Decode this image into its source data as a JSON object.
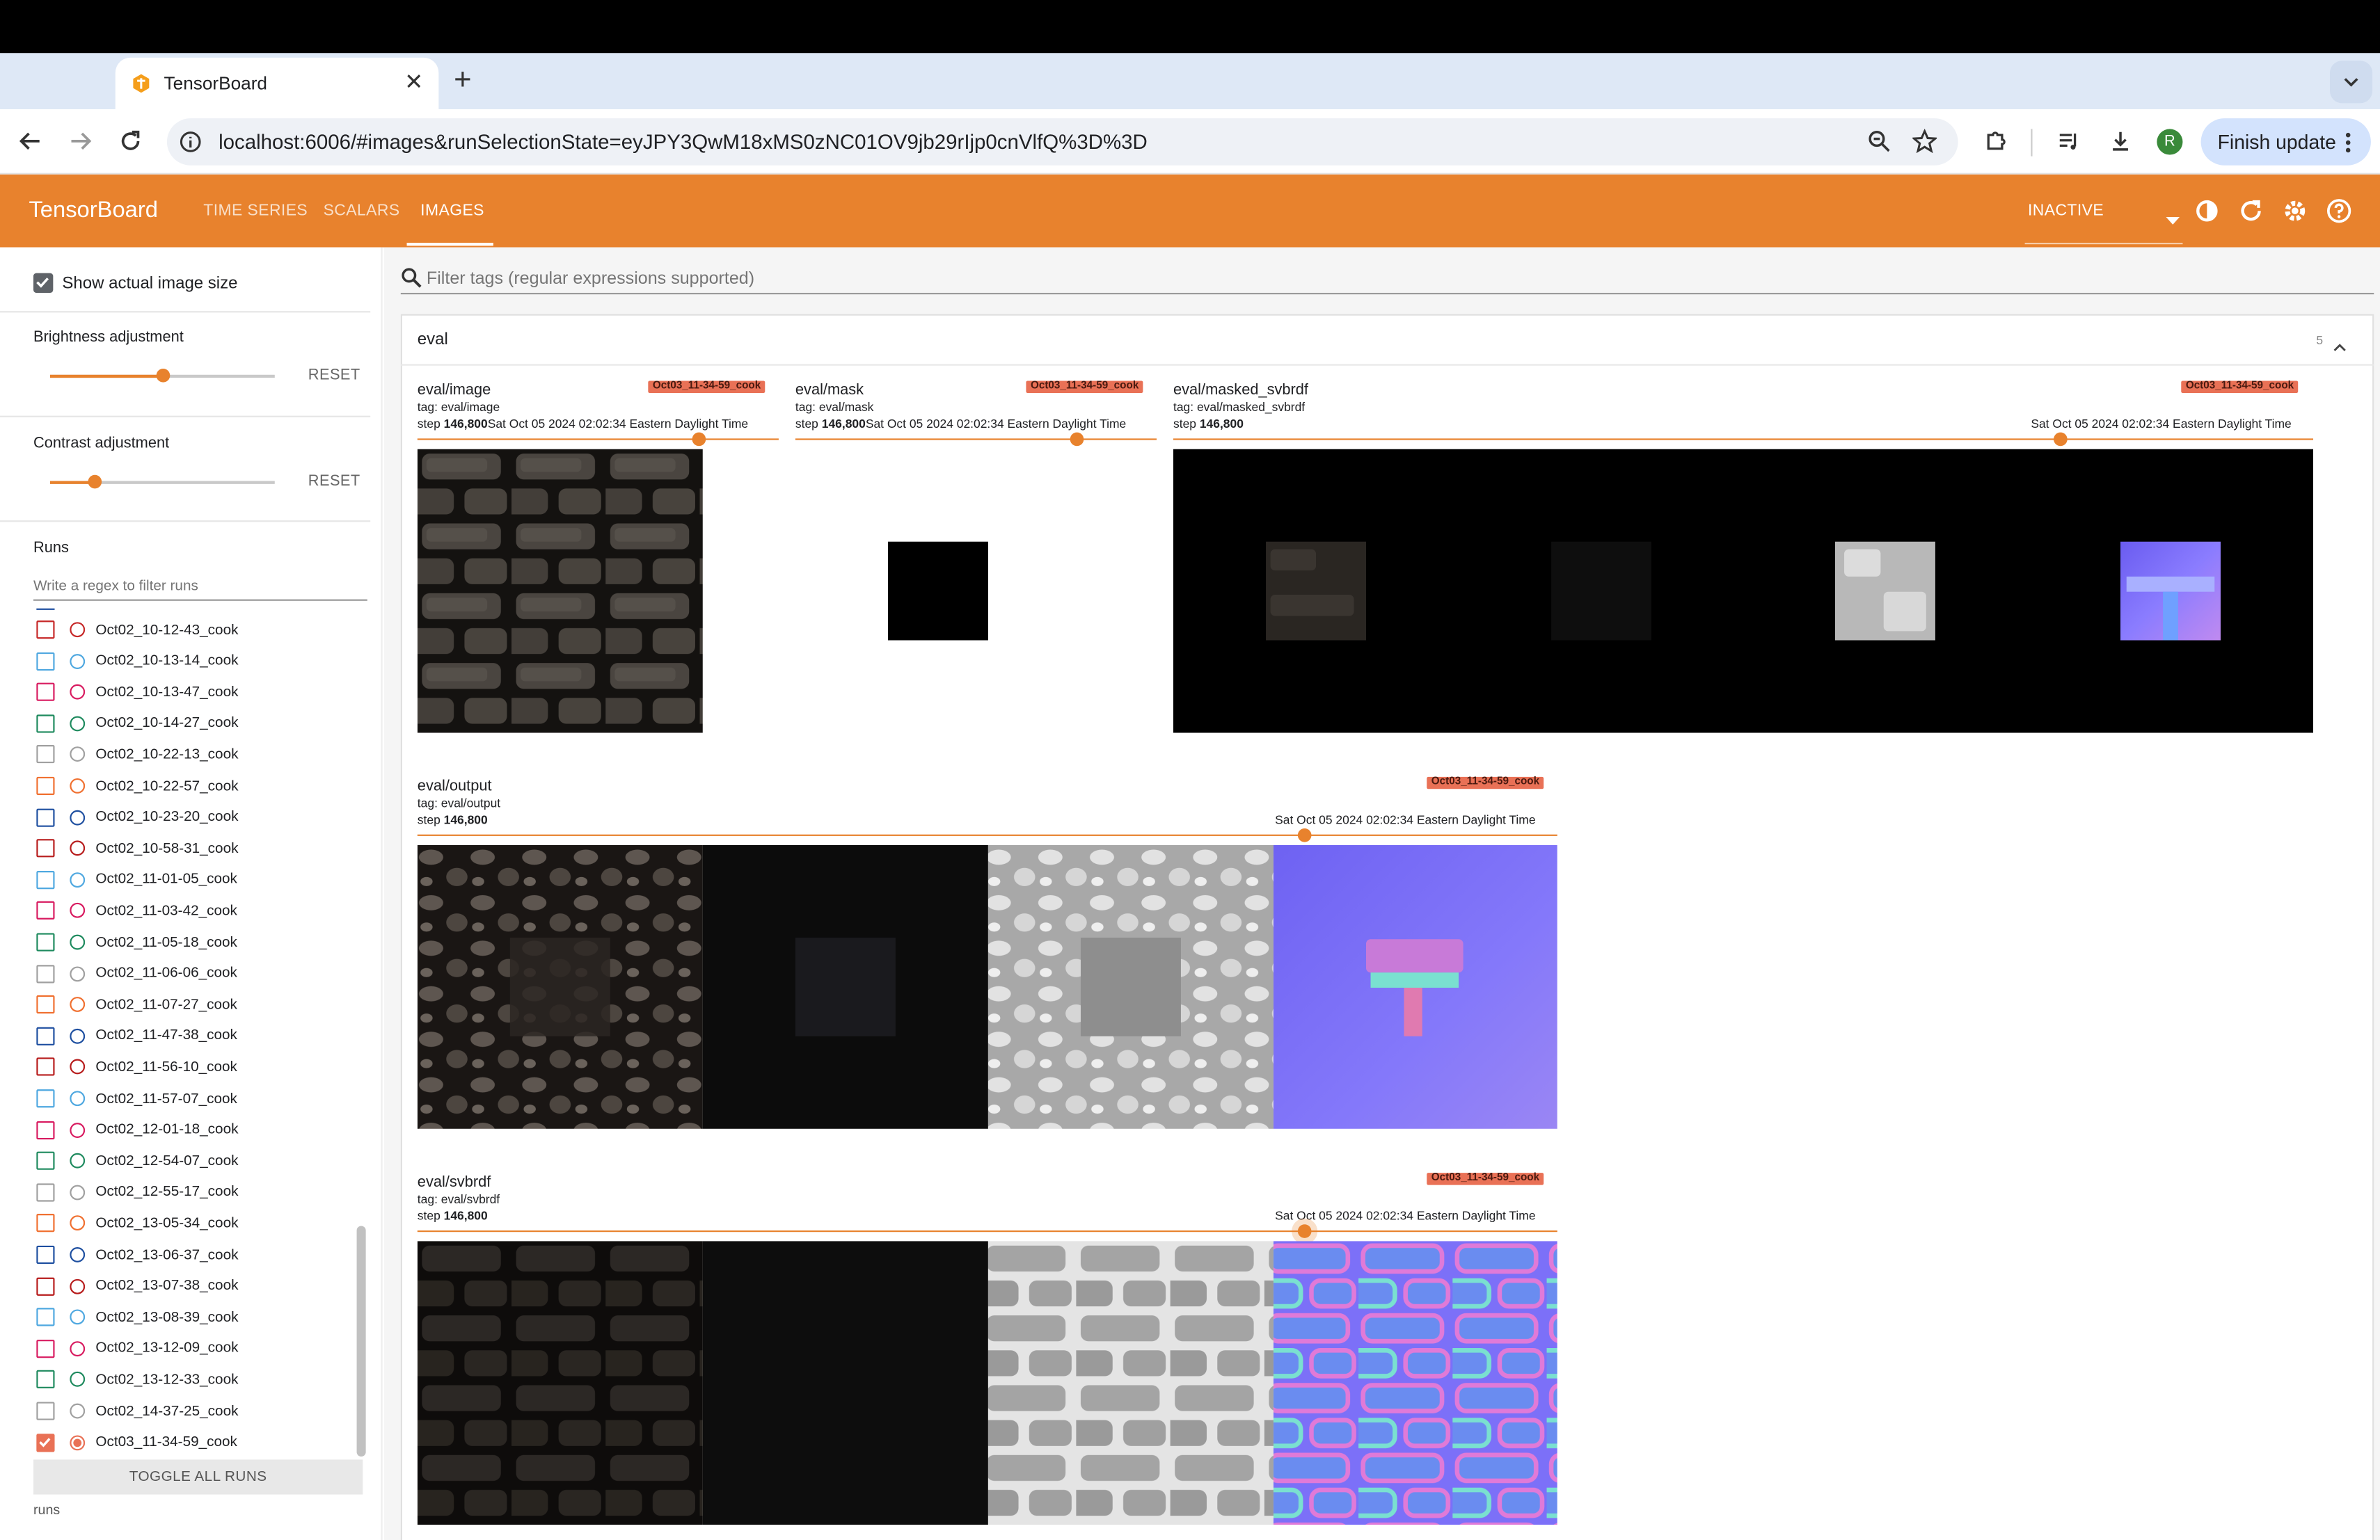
{
  "browser": {
    "tab_title": "TensorBoard",
    "url": "localhost:6006/#images&runSelectionState=eyJPY3QwM18xMS0zNC01OV9jb29rIjp0cnVlfQ%3D%3D",
    "finish_update": "Finish update",
    "avatar_letter": "R"
  },
  "app": {
    "brand": "TensorBoard",
    "tabs": [
      "TIME SERIES",
      "SCALARS",
      "IMAGES"
    ],
    "active_tab": "IMAGES",
    "status": "INACTIVE",
    "accent": "#e8822d"
  },
  "sidebar": {
    "show_actual_size": "Show actual image size",
    "brightness_label": "Brightness adjustment",
    "brightness_value": 0.5,
    "contrast_label": "Contrast adjustment",
    "contrast_value": 0.2,
    "reset": "RESET",
    "runs_title": "Runs",
    "runs_filter_placeholder": "Write a regex to filter runs",
    "runs": [
      {
        "name": "Oct02_10-12-43_cook",
        "color": "#c62828",
        "checked": false
      },
      {
        "name": "Oct02_10-13-14_cook",
        "color": "#4fa8e0",
        "checked": false
      },
      {
        "name": "Oct02_10-13-47_cook",
        "color": "#d81b60",
        "checked": false
      },
      {
        "name": "Oct02_10-14-27_cook",
        "color": "#1e8a5e",
        "checked": false
      },
      {
        "name": "Oct02_10-22-13_cook",
        "color": "#a0a0a0",
        "checked": false
      },
      {
        "name": "Oct02_10-22-57_cook",
        "color": "#f07030",
        "checked": false
      },
      {
        "name": "Oct02_10-23-20_cook",
        "color": "#1e4fa0",
        "checked": false
      },
      {
        "name": "Oct02_10-58-31_cook",
        "color": "#b71c1c",
        "checked": false
      },
      {
        "name": "Oct02_11-01-05_cook",
        "color": "#4fa8e0",
        "checked": false
      },
      {
        "name": "Oct02_11-03-42_cook",
        "color": "#d81b60",
        "checked": false
      },
      {
        "name": "Oct02_11-05-18_cook",
        "color": "#1e8a5e",
        "checked": false
      },
      {
        "name": "Oct02_11-06-06_cook",
        "color": "#a0a0a0",
        "checked": false
      },
      {
        "name": "Oct02_11-07-27_cook",
        "color": "#f07030",
        "checked": false
      },
      {
        "name": "Oct02_11-47-38_cook",
        "color": "#1e4fa0",
        "checked": false
      },
      {
        "name": "Oct02_11-56-10_cook",
        "color": "#b71c1c",
        "checked": false
      },
      {
        "name": "Oct02_11-57-07_cook",
        "color": "#4fa8e0",
        "checked": false
      },
      {
        "name": "Oct02_12-01-18_cook",
        "color": "#d81b60",
        "checked": false
      },
      {
        "name": "Oct02_12-54-07_cook",
        "color": "#1e8a5e",
        "checked": false
      },
      {
        "name": "Oct02_12-55-17_cook",
        "color": "#a0a0a0",
        "checked": false
      },
      {
        "name": "Oct02_13-05-34_cook",
        "color": "#f07030",
        "checked": false
      },
      {
        "name": "Oct02_13-06-37_cook",
        "color": "#1e4fa0",
        "checked": false
      },
      {
        "name": "Oct02_13-07-38_cook",
        "color": "#b71c1c",
        "checked": false
      },
      {
        "name": "Oct02_13-08-39_cook",
        "color": "#4fa8e0",
        "checked": false
      },
      {
        "name": "Oct02_13-12-09_cook",
        "color": "#d81b60",
        "checked": false
      },
      {
        "name": "Oct02_13-12-33_cook",
        "color": "#1e8a5e",
        "checked": false
      },
      {
        "name": "Oct02_14-37-25_cook",
        "color": "#a0a0a0",
        "checked": false
      },
      {
        "name": "Oct03_11-34-59_cook",
        "color": "#e97156",
        "checked": true
      }
    ],
    "toggle_all": "TOGGLE ALL RUNS",
    "footer": "runs"
  },
  "main": {
    "filter_placeholder": "Filter tags (regular expressions supported)",
    "group_name": "eval",
    "group_count": "5",
    "run_tag": "Oct03_11-34-59_cook",
    "cards": {
      "image": {
        "title": "eval/image",
        "tag": "tag: eval/image",
        "step_prefix": "step ",
        "step": "146,800",
        "time": "Sat Oct 05 2024 02:02:34 Eastern Daylight Time"
      },
      "mask": {
        "title": "eval/mask",
        "tag": "tag: eval/mask",
        "step_prefix": "step ",
        "step": "146,800",
        "time": "Sat Oct 05 2024 02:02:34 Eastern Daylight Time"
      },
      "masked_svbrdf": {
        "title": "eval/masked_svbrdf",
        "tag": "tag: eval/masked_svbrdf",
        "step_prefix": "step ",
        "step": "146,800",
        "time": "Sat Oct 05 2024 02:02:34 Eastern Daylight Time"
      },
      "output": {
        "title": "eval/output",
        "tag": "tag: eval/output",
        "step_prefix": "step ",
        "step": "146,800",
        "time": "Sat Oct 05 2024 02:02:34 Eastern Daylight Time"
      },
      "svbrdf": {
        "title": "eval/svbrdf",
        "tag": "tag: eval/svbrdf",
        "step_prefix": "step ",
        "step": "146,800",
        "time": "Sat Oct 05 2024 02:02:34 Eastern Daylight Time"
      }
    }
  }
}
